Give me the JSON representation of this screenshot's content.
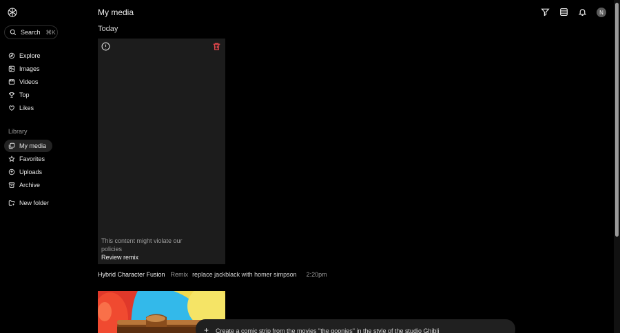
{
  "header": {
    "title": "My media",
    "avatar_initial": "N"
  },
  "sidebar": {
    "search": {
      "label": "Search",
      "shortcut": "⌘K"
    },
    "nav": [
      {
        "label": "Explore",
        "icon": "compass-icon"
      },
      {
        "label": "Images",
        "icon": "image-icon"
      },
      {
        "label": "Videos",
        "icon": "video-icon"
      },
      {
        "label": "Top",
        "icon": "trophy-icon"
      },
      {
        "label": "Likes",
        "icon": "heart-icon"
      }
    ],
    "library_label": "Library",
    "library": [
      {
        "label": "My media",
        "icon": "media-icon",
        "active": true
      },
      {
        "label": "Favorites",
        "icon": "star-icon"
      },
      {
        "label": "Uploads",
        "icon": "upload-icon"
      },
      {
        "label": "Archive",
        "icon": "archive-icon"
      }
    ],
    "new_folder": {
      "label": "New folder",
      "icon": "folder-plus-icon"
    }
  },
  "main": {
    "day_label": "Today",
    "card": {
      "warning": "This content might violate our policies",
      "action": "Review remix"
    },
    "meta": {
      "name": "Hybrid Character Fusion",
      "tag": "Remix",
      "prompt": "replace jackblack with homer simpson",
      "time": "2:20pm"
    }
  },
  "composer": {
    "text": "Create a comic strip from the movies \"the goonies\" in the style of the studio Ghibli"
  },
  "colors": {
    "background": "#000000",
    "card": "#1c1c1c",
    "delete": "#e5484d"
  }
}
